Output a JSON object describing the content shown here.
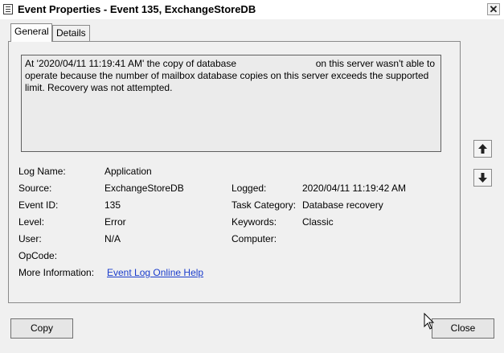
{
  "window": {
    "title": "Event Properties - Event 135, ExchangeStoreDB",
    "close_glyph": "✕"
  },
  "tabs": [
    {
      "label": "General",
      "active": true
    },
    {
      "label": "Details",
      "active": false
    }
  ],
  "description": {
    "part1": "At '2020/04/11 11:19:41 AM' the copy of database",
    "part2": "on this server wasn't able to operate because the number of mailbox database copies on this server exceeds the supported limit. Recovery was not attempted."
  },
  "fields": {
    "log_name": {
      "label": "Log Name:",
      "value": "Application"
    },
    "source": {
      "label": "Source:",
      "value": "ExchangeStoreDB"
    },
    "event_id": {
      "label": "Event ID:",
      "value": "135"
    },
    "level": {
      "label": "Level:",
      "value": "Error"
    },
    "user": {
      "label": "User:",
      "value": "N/A"
    },
    "opcode": {
      "label": "OpCode:",
      "value": ""
    },
    "more_info": {
      "label": "More Information:",
      "value": "Event Log Online Help"
    },
    "logged": {
      "label": "Logged:",
      "value": "2020/04/11 11:19:42 AM"
    },
    "task_category": {
      "label": "Task Category:",
      "value": "Database recovery"
    },
    "keywords": {
      "label": "Keywords:",
      "value": "Classic"
    },
    "computer": {
      "label": "Computer:",
      "value": ""
    }
  },
  "buttons": {
    "copy": "Copy",
    "close": "Close"
  },
  "icons": {
    "up": "arrow-up-icon",
    "down": "arrow-down-icon"
  }
}
